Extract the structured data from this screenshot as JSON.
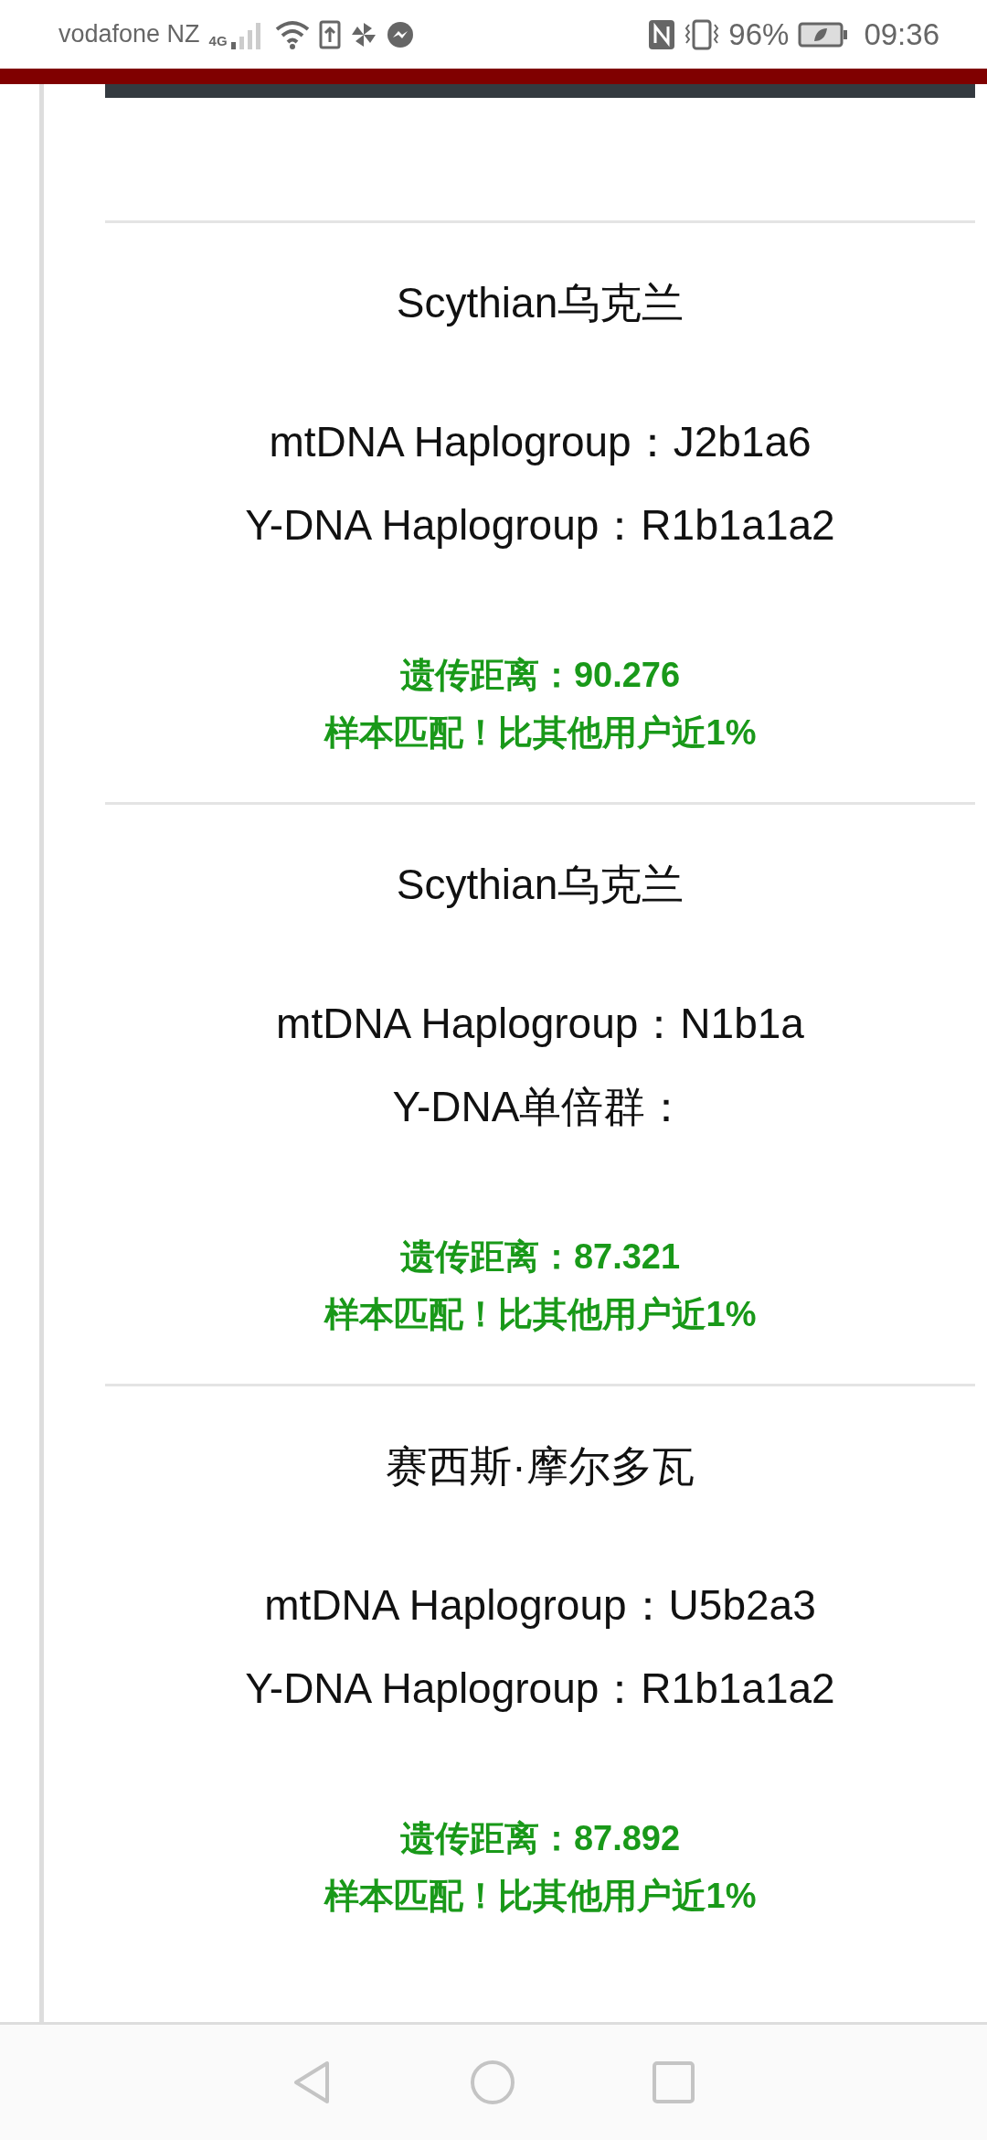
{
  "status_bar": {
    "carrier": "vodafone NZ",
    "network": "4G",
    "battery": "96%",
    "time": "09:36"
  },
  "results": [
    {
      "name": "Scythian乌克兰",
      "mtdna": "mtDNA Haplogroup：J2b1a6",
      "ydna": "Y-DNA Haplogroup：R1b1a1a2",
      "distance": "遗传距离：90.276",
      "match": "样本匹配！比其他用户近1%"
    },
    {
      "name": "Scythian乌克兰",
      "mtdna": "mtDNA Haplogroup：N1b1a",
      "ydna": "Y-DNA单倍群：",
      "distance": "遗传距离：87.321",
      "match": "样本匹配！比其他用户近1%"
    },
    {
      "name": "赛西斯·摩尔多瓦",
      "mtdna": "mtDNA Haplogroup：U5b2a3",
      "ydna": "Y-DNA Haplogroup：R1b1a1a2",
      "distance": "遗传距离：87.892",
      "match": "样本匹配！比其他用户近1%"
    }
  ]
}
